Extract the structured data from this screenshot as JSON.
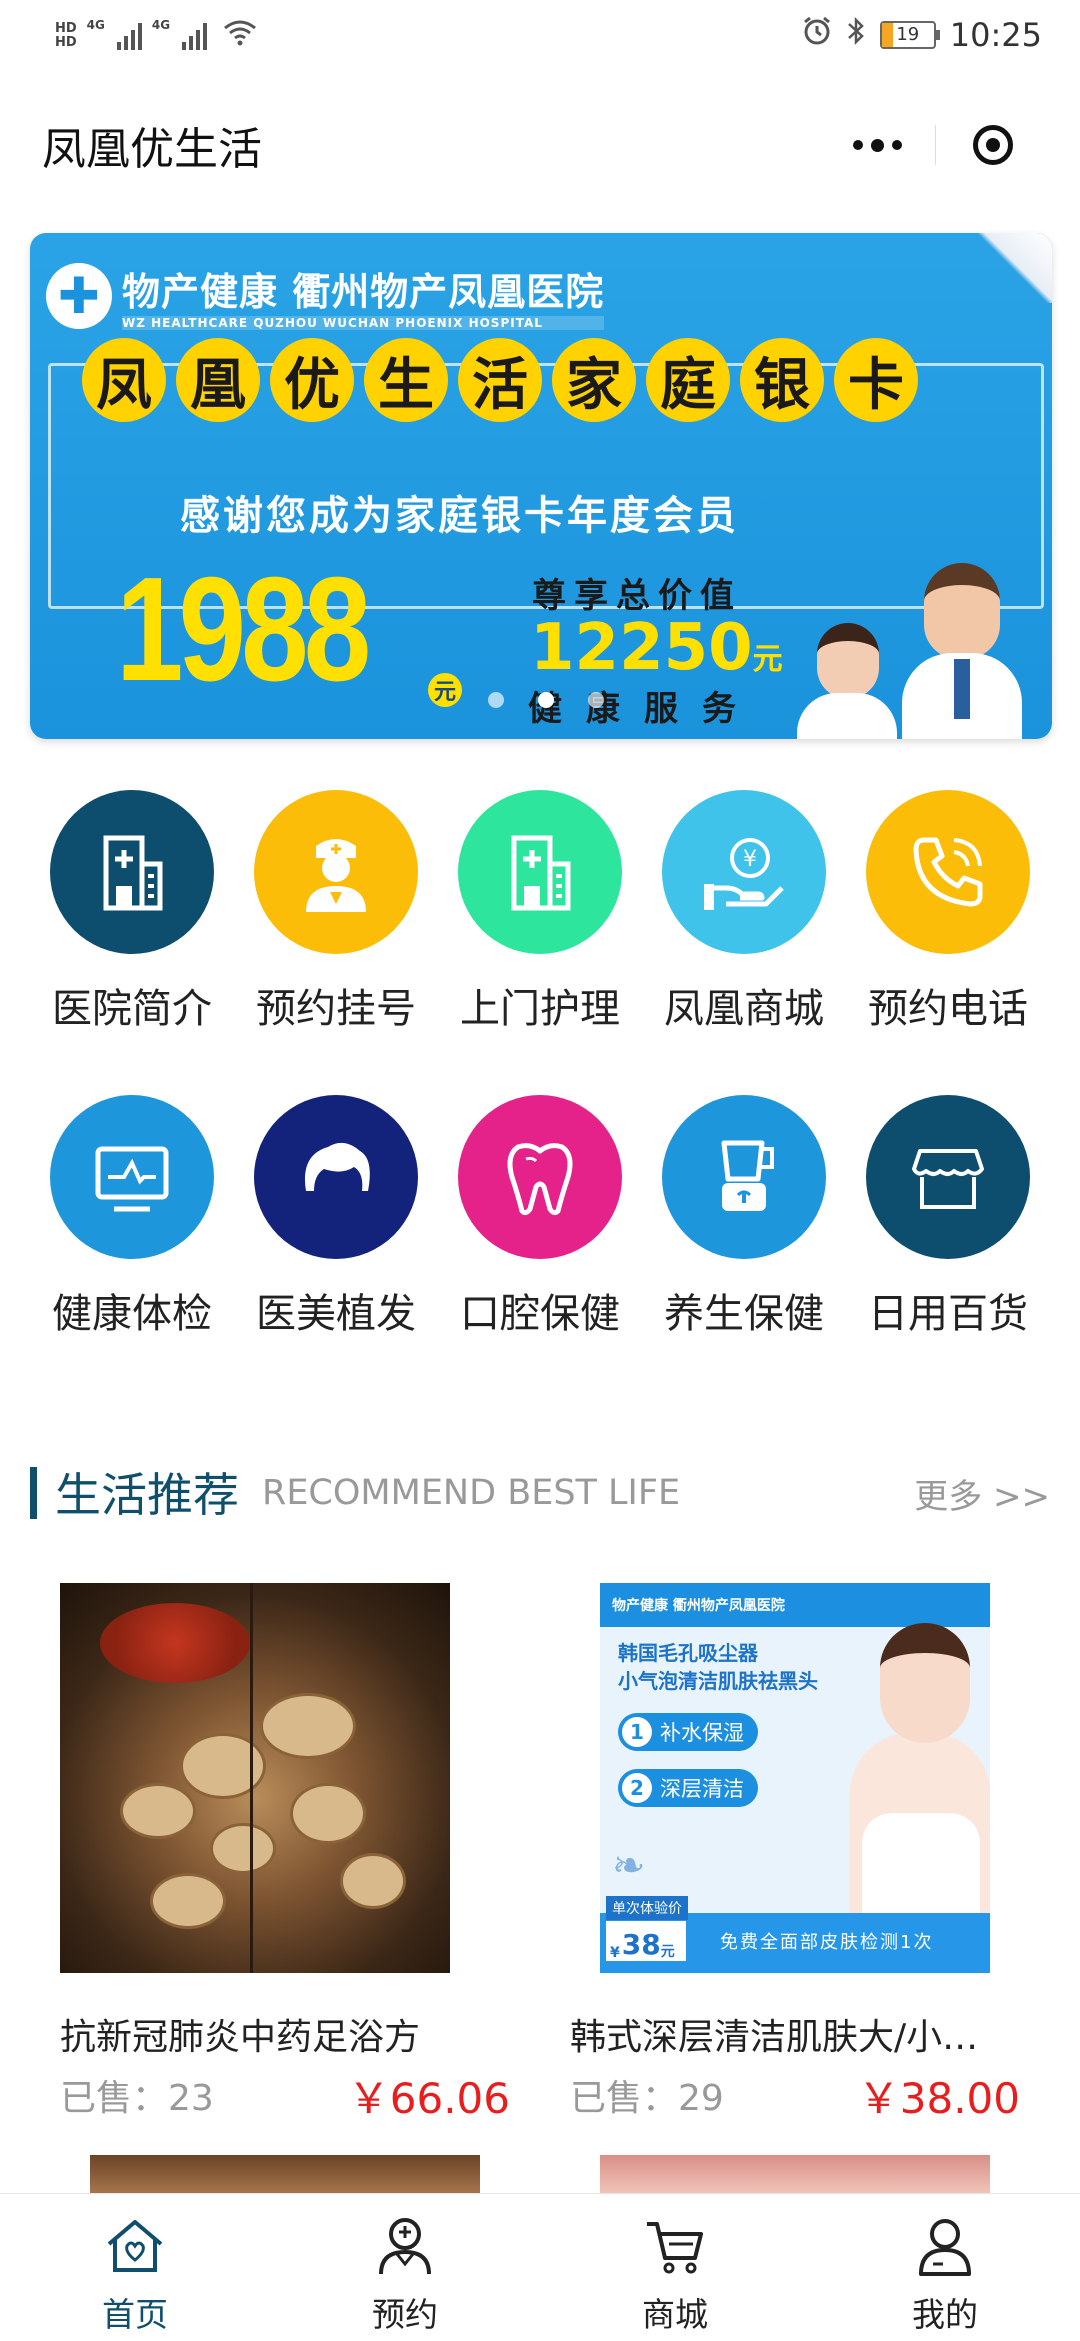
{
  "status_bar": {
    "net1": "4G",
    "net2": "4G",
    "battery": "19",
    "time": "10:25"
  },
  "header": {
    "title": "凤凰优生活"
  },
  "banner": {
    "brand_cn": "物产健康  衢州物产凤凰医院",
    "brand_en": "WZ HEALTHCARE   QUZHOU WUCHAN PHOENIX HOSPITAL",
    "headline_chars": [
      "凤",
      "凰",
      "优",
      "生",
      "活",
      "家",
      "庭",
      "银",
      "卡"
    ],
    "subtitle": "感谢您成为家庭银卡年度会员",
    "price": "1988",
    "price_unit": "元",
    "enjoy_label": "尊享总价值",
    "total_value": "12250",
    "total_unit": "元",
    "service_label": "健康服务",
    "dots": 3,
    "active_dot": 1
  },
  "services": [
    {
      "label": "医院简介",
      "icon": "hospital-icon",
      "color": "#0d4d6e"
    },
    {
      "label": "预约挂号",
      "icon": "nurse-icon",
      "color": "#fbbd08"
    },
    {
      "label": "上门护理",
      "icon": "building-icon",
      "color": "#2ee59d"
    },
    {
      "label": "凤凰商城",
      "icon": "yuan-hand-icon",
      "color": "#3fc3ea"
    },
    {
      "label": "预约电话",
      "icon": "phone-icon",
      "color": "#fbbd08"
    },
    {
      "label": "健康体检",
      "icon": "monitor-icon",
      "color": "#1e96dc"
    },
    {
      "label": "医美植发",
      "icon": "hair-icon",
      "color": "#13237b"
    },
    {
      "label": "口腔保健",
      "icon": "tooth-icon",
      "color": "#e5218a"
    },
    {
      "label": "养生保健",
      "icon": "blender-icon",
      "color": "#1e96dc"
    },
    {
      "label": "日用百货",
      "icon": "store-icon",
      "color": "#0d4d6e"
    }
  ],
  "section": {
    "title": "生活推荐",
    "subtitle": "RECOMMEND BEST LIFE",
    "more": "更多 >>"
  },
  "products": [
    {
      "name": "抗新冠肺炎中药足浴方",
      "sold_label": "已售：",
      "sold": "23",
      "price": "￥66.06"
    },
    {
      "name": "韩式深层清洁肌肤大/小…",
      "sold_label": "已售：",
      "sold": "29",
      "price": "￥38.00",
      "ad": {
        "top_band": "物产健康 衢州物产凤凰医院",
        "headline1": "韩国毛孔吸尘器",
        "headline2": "小气泡清洁肌肤祛黑头",
        "pill1": "补水保湿",
        "pill2": "深层清洁",
        "price_label": "单次体验价",
        "price_value": "38",
        "price_unit": "元",
        "free_text": "免费全面部皮肤检测1次"
      }
    }
  ],
  "tabbar": [
    {
      "label": "首页",
      "icon": "home-icon",
      "active": true
    },
    {
      "label": "预约",
      "icon": "doctor-icon",
      "active": false
    },
    {
      "label": "商城",
      "icon": "cart-icon",
      "active": false
    },
    {
      "label": "我的",
      "icon": "user-icon",
      "active": false
    }
  ]
}
